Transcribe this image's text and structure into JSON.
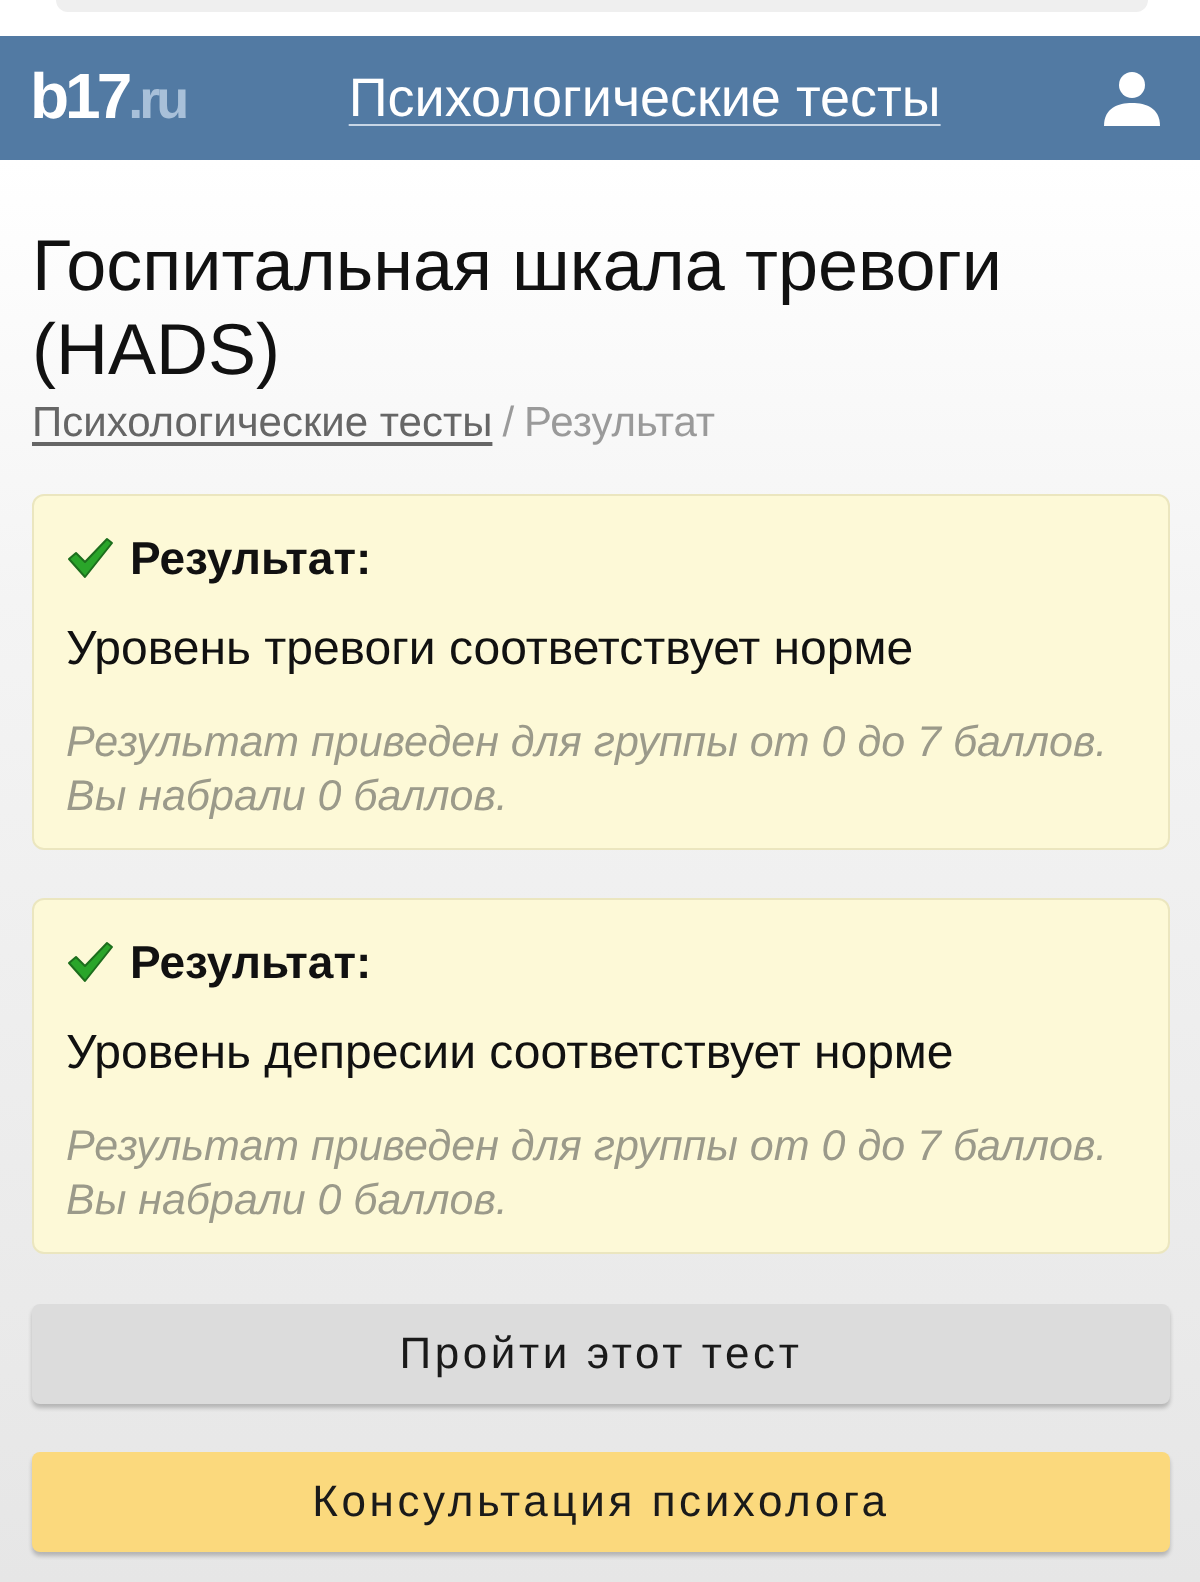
{
  "header": {
    "logo": {
      "name": "b17",
      "domain": ".ru"
    },
    "nav_link": "Психологические тесты"
  },
  "title": "Госпитальная шкала тревоги (HADS)",
  "breadcrumb": {
    "items": [
      {
        "label": "Психологические тесты",
        "kind": "link"
      },
      {
        "label": "Результат",
        "kind": "current"
      }
    ],
    "separator": "/"
  },
  "results": [
    {
      "heading": "Результат:",
      "verdict": "Уровень тревоги соответствует норме",
      "note": [
        "Результат приведен для группы от 0 до 7 баллов.",
        "Вы набрали 0 баллов."
      ]
    },
    {
      "heading": "Результат:",
      "verdict": "Уровень депресии соответствует норме",
      "note": [
        "Результат приведен для группы от 0 до 7 баллов.",
        "Вы набрали 0 баллов."
      ]
    }
  ],
  "buttons": [
    {
      "label": "Пройти этот тест",
      "kind": "secondary"
    },
    {
      "label": "Консультация психолога",
      "kind": "primary"
    }
  ]
}
